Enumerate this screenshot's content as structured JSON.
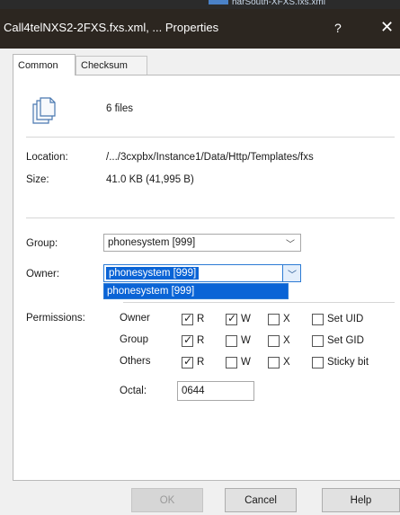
{
  "background_window": {
    "title_fragment": "harSouth-XFXS.fxs.xml"
  },
  "window": {
    "title": "Call4telNXS2-2FXS.fxs.xml, ... Properties",
    "help_glyph": "?",
    "close_glyph": "✕"
  },
  "tabs": [
    {
      "label": "Common",
      "active": true
    },
    {
      "label": "Checksum",
      "active": false
    }
  ],
  "summary": {
    "icon": "files-icon",
    "count_text": "6 files"
  },
  "info": {
    "location_label": "Location:",
    "location_value": "/.../3cxpbx/Instance1/Data/Http/Templates/fxs",
    "size_label": "Size:",
    "size_value": "41.0 KB (41,995 B)"
  },
  "ownership": {
    "group_label": "Group:",
    "group_value": "phonesystem [999]",
    "owner_label": "Owner:",
    "owner_value": "phonesystem [999]",
    "owner_dropdown_options": [
      "phonesystem [999]"
    ]
  },
  "permissions": {
    "label": "Permissions:",
    "rows": [
      {
        "who": "Owner",
        "r": true,
        "w": true,
        "x": false,
        "special_label": "Set UID",
        "special": false
      },
      {
        "who": "Group",
        "r": true,
        "w": false,
        "x": false,
        "special_label": "Set GID",
        "special": false
      },
      {
        "who": "Others",
        "r": true,
        "w": false,
        "x": false,
        "special_label": "Sticky bit",
        "special": false
      }
    ],
    "r_label": "R",
    "w_label": "W",
    "x_label": "X",
    "octal_label": "Octal:",
    "octal_value": "0644"
  },
  "buttons": {
    "ok": "OK",
    "cancel": "Cancel",
    "help": "Help"
  }
}
